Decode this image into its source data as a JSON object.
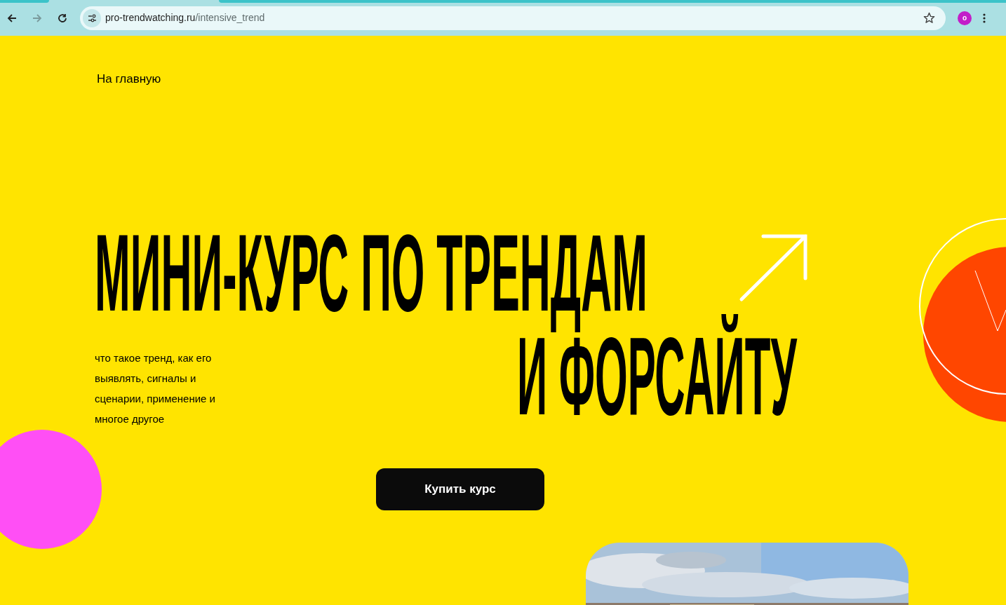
{
  "browser": {
    "url_host": "pro-trendwatching.ru",
    "url_path": "/intensive_trend",
    "profile_initial": "o"
  },
  "nav": {
    "home_link": "На главную"
  },
  "hero": {
    "title_lines": [
      "МИНИ-КУРС ПО ТРЕНДАМ",
      "И ФОРСАЙТУ"
    ],
    "description_lines": [
      "что такое тренд, как его",
      "выявлять, сигналы и",
      "сценарии, применение и",
      "многое другое"
    ],
    "button": "Купить курс"
  }
}
